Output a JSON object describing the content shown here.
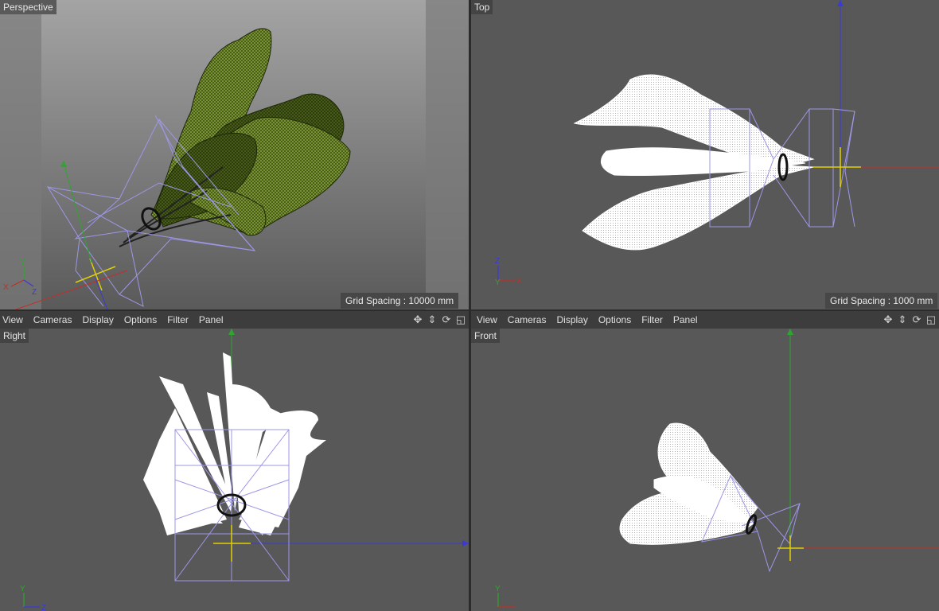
{
  "viewports": {
    "perspective": {
      "label": "Perspective",
      "grid_spacing": "Grid Spacing : 10000 mm"
    },
    "top": {
      "label": "Top",
      "grid_spacing": "Grid Spacing : 1000 mm"
    },
    "right": {
      "label": "Right"
    },
    "front": {
      "label": "Front"
    }
  },
  "toolbar_left": {
    "items": [
      "View",
      "Cameras",
      "Display",
      "Options",
      "Filter",
      "Panel"
    ]
  },
  "toolbar_right": {
    "items": [
      "View",
      "Cameras",
      "Display",
      "Options",
      "Filter",
      "Panel"
    ]
  },
  "toolbar_icons": [
    "move-view-icon",
    "zoom-view-icon",
    "rotate-view-icon",
    "maximize-view-icon"
  ],
  "axis_labels": {
    "x": "X",
    "y": "Y",
    "z": "Z"
  },
  "colors": {
    "viewport_bg": "#585858",
    "cage": "#9c97e6",
    "axis_x": "#c0302a",
    "axis_y": "#2ea52e",
    "axis_z": "#3a3ad8",
    "leaf_green": "#6f8a2a",
    "mesh_white": "#ffffff",
    "null_yellow": "#e0d000"
  }
}
